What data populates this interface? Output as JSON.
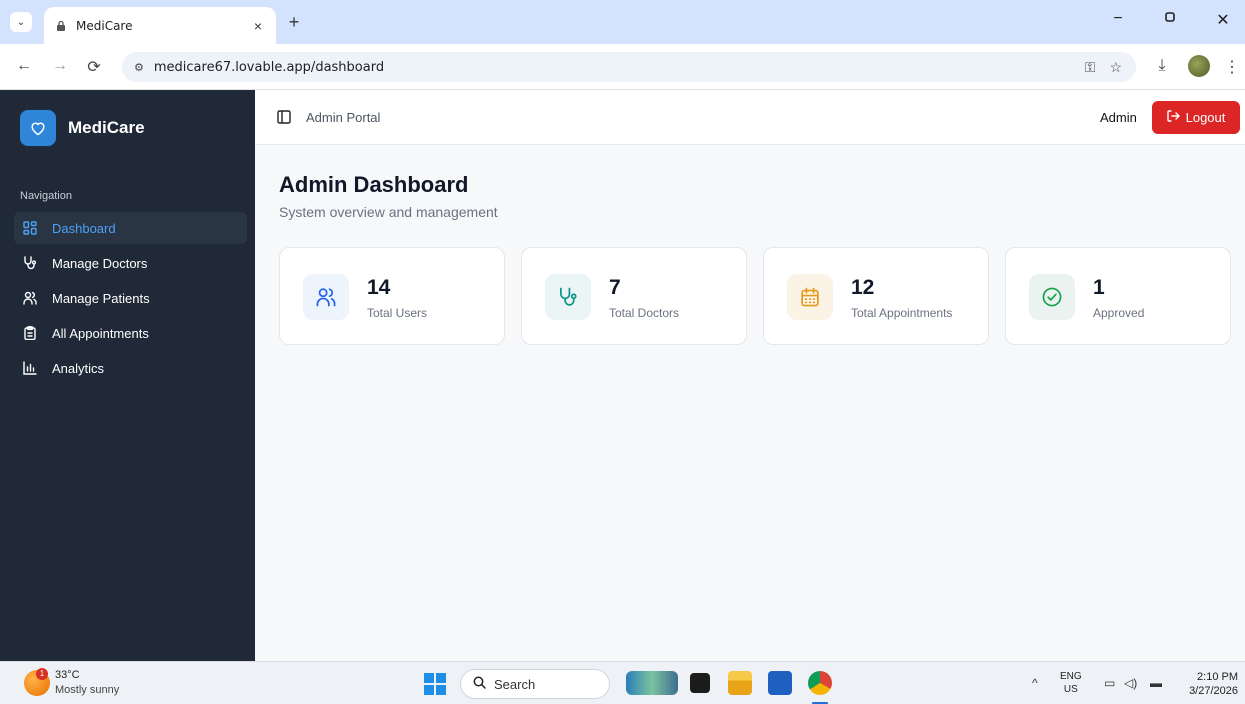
{
  "browser": {
    "tab_title": "MediCare",
    "tab_close": "×",
    "new_tab": "+",
    "url": "medicare67.lovable.app/dashboard",
    "window_controls": {
      "minimize": "−",
      "restore": "▢",
      "close": "✕"
    }
  },
  "app": {
    "brand": "MediCare",
    "nav_heading": "Navigation",
    "nav_items": [
      {
        "label": "Dashboard",
        "icon": "grid-icon",
        "active": true
      },
      {
        "label": "Manage Doctors",
        "icon": "stethoscope-icon",
        "active": false
      },
      {
        "label": "Manage Patients",
        "icon": "users-icon",
        "active": false
      },
      {
        "label": "All Appointments",
        "icon": "clipboard-icon",
        "active": false
      },
      {
        "label": "Analytics",
        "icon": "bar-chart-icon",
        "active": false
      }
    ],
    "topbar": {
      "portal": "Admin Portal",
      "user": "Admin",
      "logout": "Logout"
    },
    "page": {
      "title": "Admin Dashboard",
      "subtitle": "System overview and management"
    },
    "stats": [
      {
        "value": "14",
        "label": "Total Users",
        "icon": "users-icon",
        "color": "#2563eb",
        "bg": "#eef4fc"
      },
      {
        "value": "7",
        "label": "Total Doctors",
        "icon": "stethoscope-icon",
        "color": "#0d9488",
        "bg": "#ecf5f6"
      },
      {
        "value": "12",
        "label": "Total Appointments",
        "icon": "calendar-icon",
        "color": "#e69a1b",
        "bg": "#fbf3e6"
      },
      {
        "value": "1",
        "label": "Approved",
        "icon": "check-circle-icon",
        "color": "#16a34a",
        "bg": "#ebf3f0"
      }
    ]
  },
  "taskbar": {
    "weather_badge": "1",
    "temperature": "33°C",
    "weather": "Mostly sunny",
    "search": "Search",
    "lang_top": "ENG",
    "lang_bottom": "US",
    "time": "2:10 PM",
    "date": "3/27/2026"
  },
  "colors": {
    "sidebar": "#1f2937",
    "accent": "#4ea1f5",
    "logout": "#dc2626"
  }
}
